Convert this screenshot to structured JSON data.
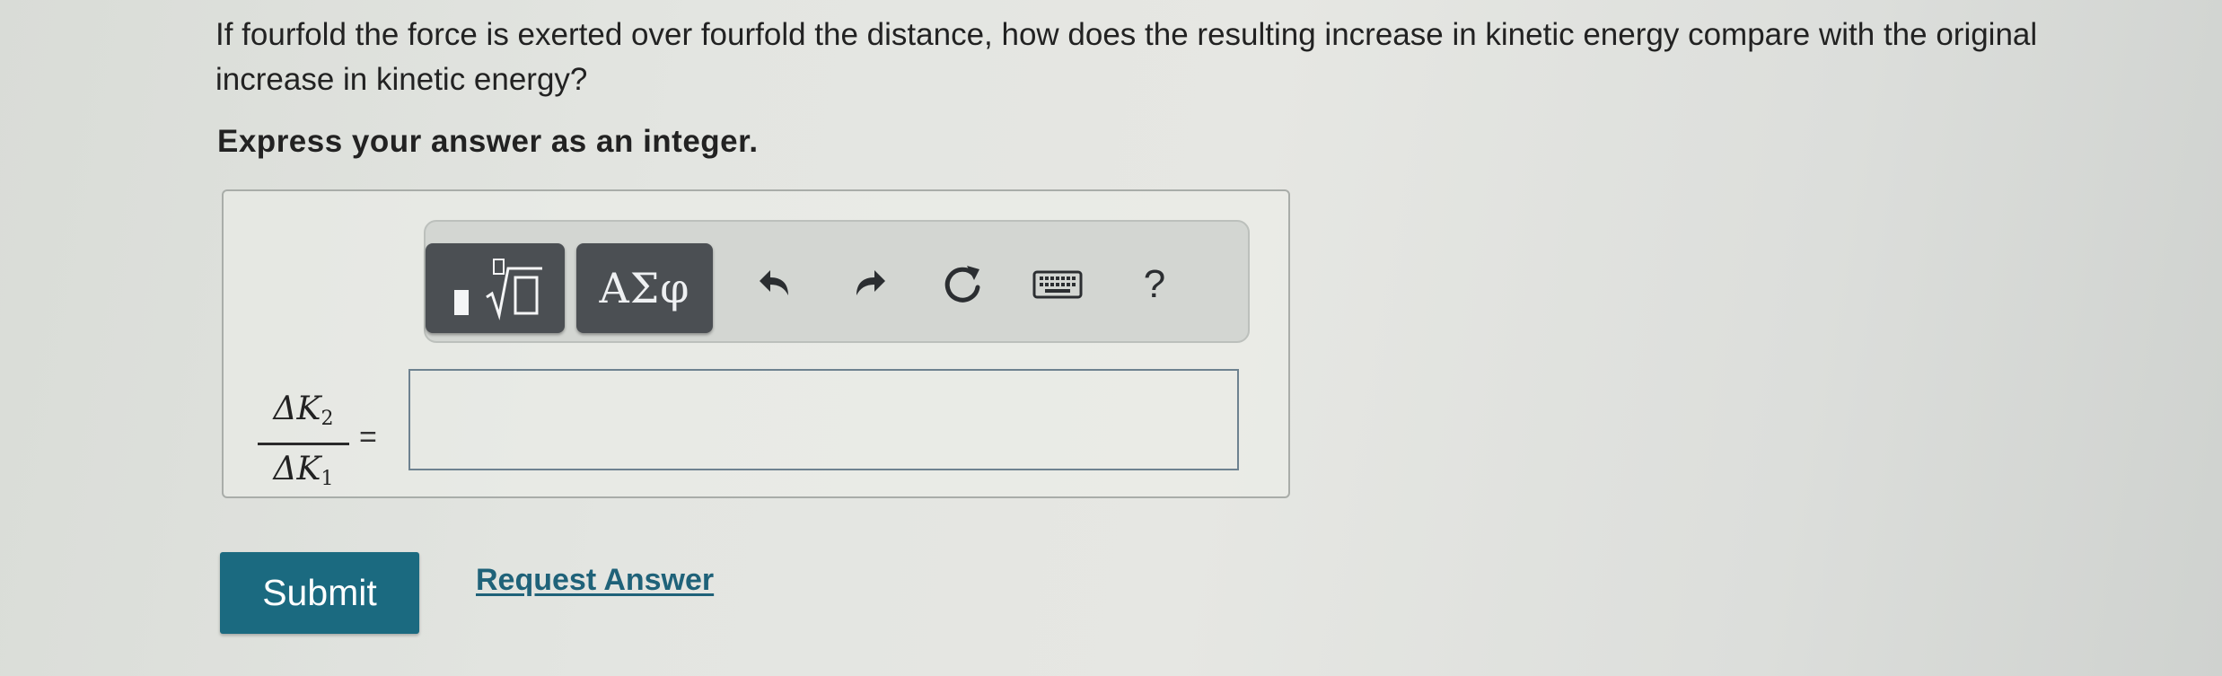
{
  "question": {
    "text": "If fourfold the force is exerted over fourfold the distance, how does the resulting increase in kinetic energy compare with the original increase in kinetic energy?",
    "instruction": "Express your answer as an integer."
  },
  "toolbar": {
    "templates_icon": "fraction-root-template-icon",
    "symbols_label": "ΑΣφ",
    "undo_icon": "undo-icon",
    "redo_icon": "redo-icon",
    "reset_icon": "reset-icon",
    "keyboard_icon": "keyboard-icon",
    "help_label": "?"
  },
  "answer": {
    "numerator_symbol": "ΔK",
    "numerator_subscript": "2",
    "denominator_symbol": "ΔK",
    "denominator_subscript": "1",
    "equals": "=",
    "value": "",
    "placeholder": ""
  },
  "actions": {
    "submit_label": "Submit",
    "request_answer_label": "Request Answer"
  },
  "colors": {
    "submit_bg": "#1b6a80",
    "link": "#1f6279",
    "toolbar_button": "#4b4f53"
  }
}
